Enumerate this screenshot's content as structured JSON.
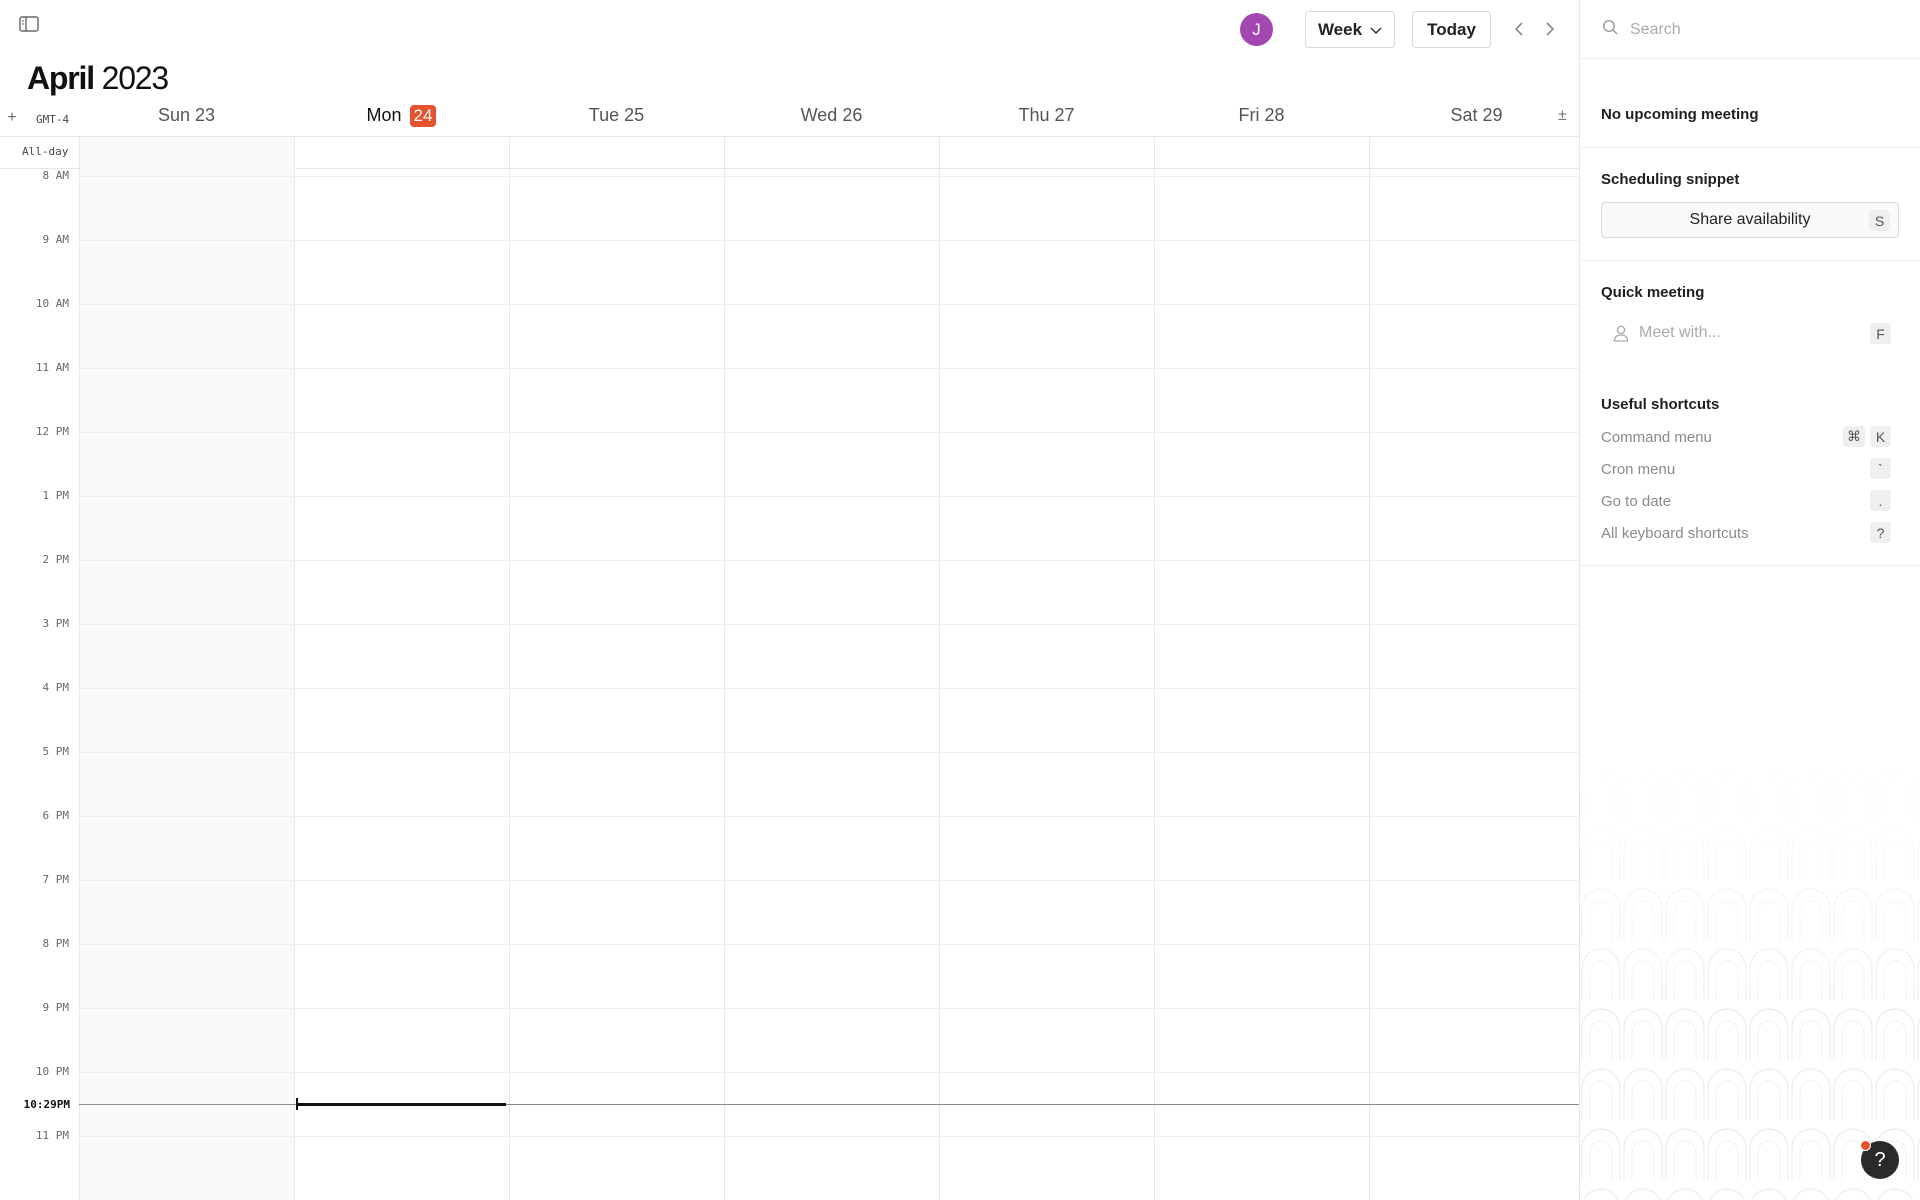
{
  "header": {
    "month": "April",
    "year": "2023",
    "avatar_initial": "J",
    "view_label": "Week",
    "today_label": "Today"
  },
  "calendar": {
    "timezone": "GMT-4",
    "allday_label": "All-day",
    "days": [
      {
        "name": "Sun",
        "date": "23"
      },
      {
        "name": "Mon",
        "date": "24"
      },
      {
        "name": "Tue",
        "date": "25"
      },
      {
        "name": "Wed",
        "date": "26"
      },
      {
        "name": "Thu",
        "date": "27"
      },
      {
        "name": "Fri",
        "date": "28"
      },
      {
        "name": "Sat",
        "date": "29"
      }
    ],
    "hours": [
      "8 AM",
      "9 AM",
      "10 AM",
      "11 AM",
      "12 PM",
      "1 PM",
      "2 PM",
      "3 PM",
      "4 PM",
      "5 PM",
      "6 PM",
      "7 PM",
      "8 PM",
      "9 PM",
      "10 PM",
      "11 PM"
    ],
    "current_time": "10:29PM",
    "today_color": "#e5532c"
  },
  "panel": {
    "search_placeholder": "Search",
    "upcoming": "No upcoming meeting",
    "scheduling_title": "Scheduling snippet",
    "share_label": "Share availability",
    "share_key": "S",
    "quick_title": "Quick meeting",
    "meet_placeholder": "Meet with...",
    "meet_key": "F",
    "shortcuts_title": "Useful shortcuts",
    "shortcuts": [
      {
        "label": "Command menu",
        "keys": [
          "⌘",
          "K"
        ]
      },
      {
        "label": "Cron menu",
        "keys": [
          "`"
        ]
      },
      {
        "label": "Go to date",
        "keys": [
          "."
        ]
      },
      {
        "label": "All keyboard shortcuts",
        "keys": [
          "?"
        ]
      }
    ]
  },
  "help": {
    "label": "?",
    "dot_color": "#e5532c"
  },
  "avatar_color": "#a347b3"
}
